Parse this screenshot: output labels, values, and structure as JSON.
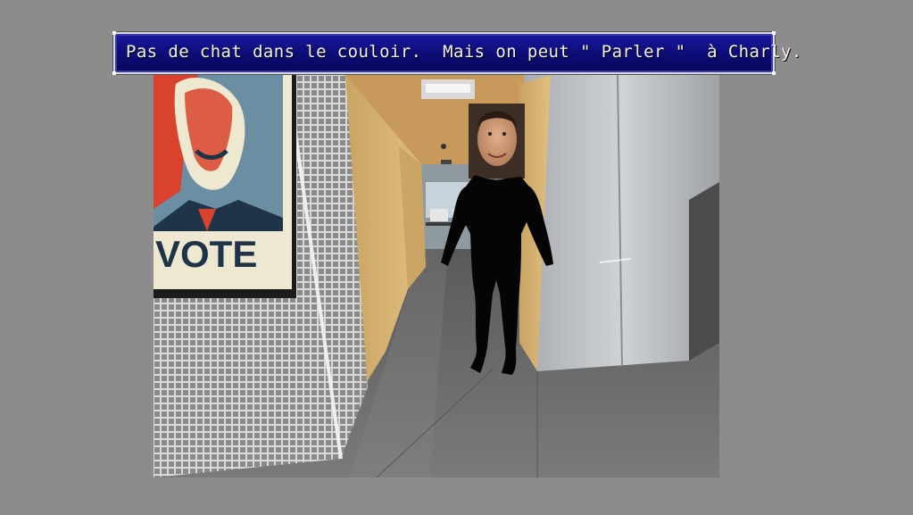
{
  "dialog": {
    "text": "Pas de chat dans le couloir.  Mais on peut \" Parler \"  à Charly."
  },
  "scene": {
    "poster": {
      "word": "VOTE"
    },
    "character": {
      "name": "Charly"
    }
  },
  "colors": {
    "background": "#8c8c8c",
    "dialog_top": "#1a1aa0",
    "dialog_bottom": "#07075a",
    "dialog_border": "#d7d7e6",
    "dialog_text": "#f2f2f2",
    "poster_red": "#d9432e",
    "poster_blue": "#6b8ea3",
    "poster_cream": "#efe8d0",
    "poster_navy": "#1f3448",
    "wood_panel": "#d7b370",
    "steel_panel": "#b9bcc0",
    "floor": "#6e6e6e",
    "silhouette": "#050505"
  }
}
